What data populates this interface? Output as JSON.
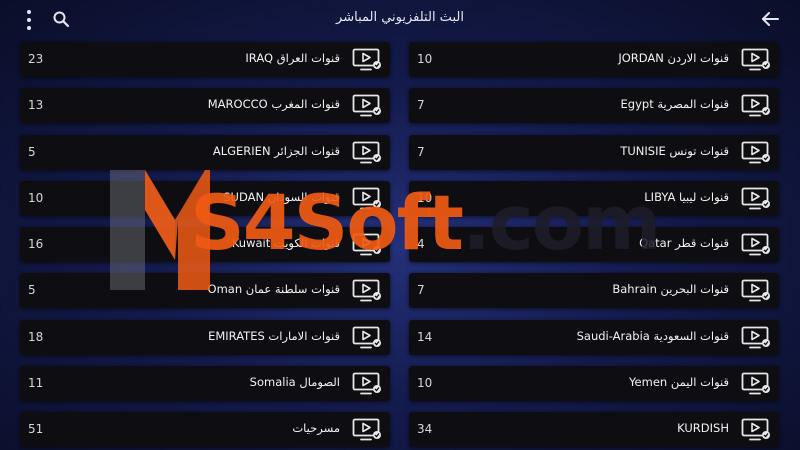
{
  "header": {
    "title": "البث التلفزيوني المباشر"
  },
  "icons": {
    "menu": "more-vertical-icon",
    "search": "search-icon",
    "back": "arrow-left-icon",
    "channel": "tv-play-icon"
  },
  "colors": {
    "background": "#141b4d",
    "row_background": "#0e0e12",
    "watermark_orange": "#f05a14",
    "text": "#f2f2f2"
  },
  "left_column": [
    {
      "count": "23",
      "name": "قنوات العراق IRAQ"
    },
    {
      "count": "13",
      "name": "قنوات المغرب MAROCCO"
    },
    {
      "count": "5",
      "name": "قنوات الجزائر ALGERIEN"
    },
    {
      "count": "10",
      "name": "قنوات السودان SUDAN"
    },
    {
      "count": "16",
      "name": "قنوات الكويت Kuwait"
    },
    {
      "count": "5",
      "name": "قنوات سلطنة عمان Oman"
    },
    {
      "count": "18",
      "name": "قنوات الامارات EMIRATES"
    },
    {
      "count": "11",
      "name": "الصومال Somalia"
    },
    {
      "count": "51",
      "name": "مسرحيات"
    }
  ],
  "right_column": [
    {
      "count": "10",
      "name": "قنوات الاردن JORDAN"
    },
    {
      "count": "7",
      "name": "قنوات المصرية Egypt"
    },
    {
      "count": "7",
      "name": "قنوات تونس TUNISIE"
    },
    {
      "count": "10",
      "name": "قنوات ليبيا LIBYA"
    },
    {
      "count": "4",
      "name": "قنوات قطر Qatar"
    },
    {
      "count": "7",
      "name": "قنوات البحرين Bahrain"
    },
    {
      "count": "14",
      "name": "قنوات السعودية Saudi-Arabia"
    },
    {
      "count": "10",
      "name": "قنوات اليمن Yemen"
    },
    {
      "count": "34",
      "name": "KURDISH"
    }
  ],
  "watermark": {
    "text_orange": "S4Soft",
    "text_dark": ".com"
  }
}
